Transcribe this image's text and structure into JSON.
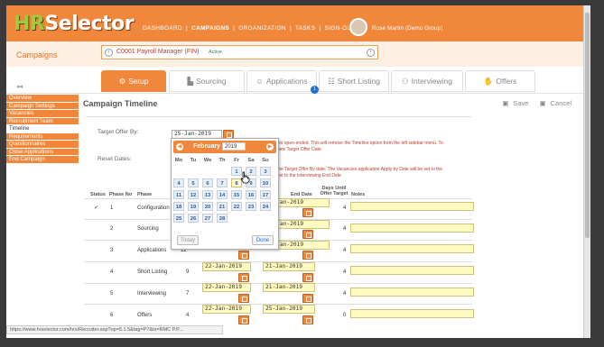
{
  "header": {
    "logo_hr": "HR",
    "logo_rest": "Selector",
    "nav": [
      "DASHBOARD",
      "CAMPAIGNS",
      "ORGANIZATION",
      "TASKS",
      "SIGN-OUT"
    ],
    "nav_sep": "|",
    "active_nav": "CAMPAIGNS",
    "user_name": "Rose Martin (Demo Group)"
  },
  "subbar": {
    "crumb": "Campaigns",
    "campaign_title": "C0001 Payroll Manager (FIN)",
    "campaign_status": "Active"
  },
  "tabs": [
    {
      "label": "Setup",
      "icon": "gear-icon",
      "active": true
    },
    {
      "label": "Sourcing",
      "icon": "factory-icon",
      "active": false
    },
    {
      "label": "Applications",
      "icon": "people-icon",
      "active": false,
      "badge": "1"
    },
    {
      "label": "Short Listing",
      "icon": "group-icon",
      "active": false
    },
    {
      "label": "Interviewing",
      "icon": "interview-icon",
      "active": false
    },
    {
      "label": "Offers",
      "icon": "handshake-icon",
      "active": false
    }
  ],
  "sidebar": {
    "collapse_glyph": "◂◂",
    "items": [
      {
        "label": "Overview"
      },
      {
        "label": "Campaign Settings"
      },
      {
        "label": "Vacancies"
      },
      {
        "label": "Recruitment Team"
      },
      {
        "label": "Timeline",
        "selected": true
      },
      {
        "label": "Requirements"
      },
      {
        "label": "Questionnaires"
      },
      {
        "label": "Close Applications"
      },
      {
        "label": "End Campaign"
      }
    ]
  },
  "main": {
    "title": "Campaign Timeline",
    "save": "Save",
    "cancel": "Cancel",
    "target_offer_label": "Target Offer By:",
    "target_offer_value": "25-Jan-2019",
    "reset_dates_label": "Reset Dates:",
    "note1_line1": "ies open-ended. This will remove the Timeline option from the left sidebar menu. To",
    "note1_line2": "new Target Offer Date",
    "note2_line1": "the Target Offer By date. The Vacancies application Apply by Date will be set to the",
    "note2_line2": "set to the Interviewing End Date"
  },
  "table": {
    "headers": {
      "status": "Status",
      "phase_no": "Phase No",
      "phase": "Phase",
      "end_date": "End Date",
      "days_until": "Days Until",
      "offer_target": "Offer Target",
      "notes": "Notes"
    },
    "rows": [
      {
        "status": "✓",
        "no": "1",
        "phase": "Configuration",
        "days": "",
        "start": "",
        "end": "an-2019",
        "until": "4"
      },
      {
        "status": "",
        "no": "2",
        "phase": "Sourcing",
        "days": "",
        "start": "",
        "end": "an-2019",
        "until": "4"
      },
      {
        "status": "",
        "no": "3",
        "phase": "Applications",
        "days": "12",
        "start": "",
        "end": "an-2019",
        "until": "4"
      },
      {
        "status": "",
        "no": "4",
        "phase": "Short Listing",
        "days": "9",
        "start": "22-Jan-2019",
        "end": "21-Jan-2019",
        "until": "4"
      },
      {
        "status": "",
        "no": "5",
        "phase": "Interviewing",
        "days": "7",
        "start": "22-Jan-2019",
        "end": "21-Jan-2019",
        "until": "4"
      },
      {
        "status": "",
        "no": "6",
        "phase": "Offers",
        "days": "4",
        "start": "22-Jan-2019",
        "end": "25-Jan-2019",
        "until": "0"
      }
    ]
  },
  "calendar": {
    "month": "February",
    "year": "2019",
    "dow": [
      "Mo",
      "Tu",
      "We",
      "Th",
      "Fr",
      "Sa",
      "Su"
    ],
    "weeks": [
      [
        "",
        "",
        "",
        "",
        "1",
        "2",
        "3"
      ],
      [
        "4",
        "5",
        "6",
        "7",
        "8",
        "9",
        "10"
      ],
      [
        "11",
        "12",
        "13",
        "14",
        "15",
        "16",
        "17"
      ],
      [
        "18",
        "19",
        "20",
        "21",
        "22",
        "23",
        "24"
      ],
      [
        "25",
        "26",
        "27",
        "28",
        "",
        "",
        ""
      ]
    ],
    "today": "Today",
    "done": "Done"
  },
  "status_bar": "https://www.hrselector.com/hrs/Recruiter.asp?op=5.1.5&tag=P7&ts=RMC P.P...",
  "colors": {
    "brand": "#f0873a",
    "accent_green": "#9ccc3a",
    "link_blue": "#1e6fd9"
  }
}
